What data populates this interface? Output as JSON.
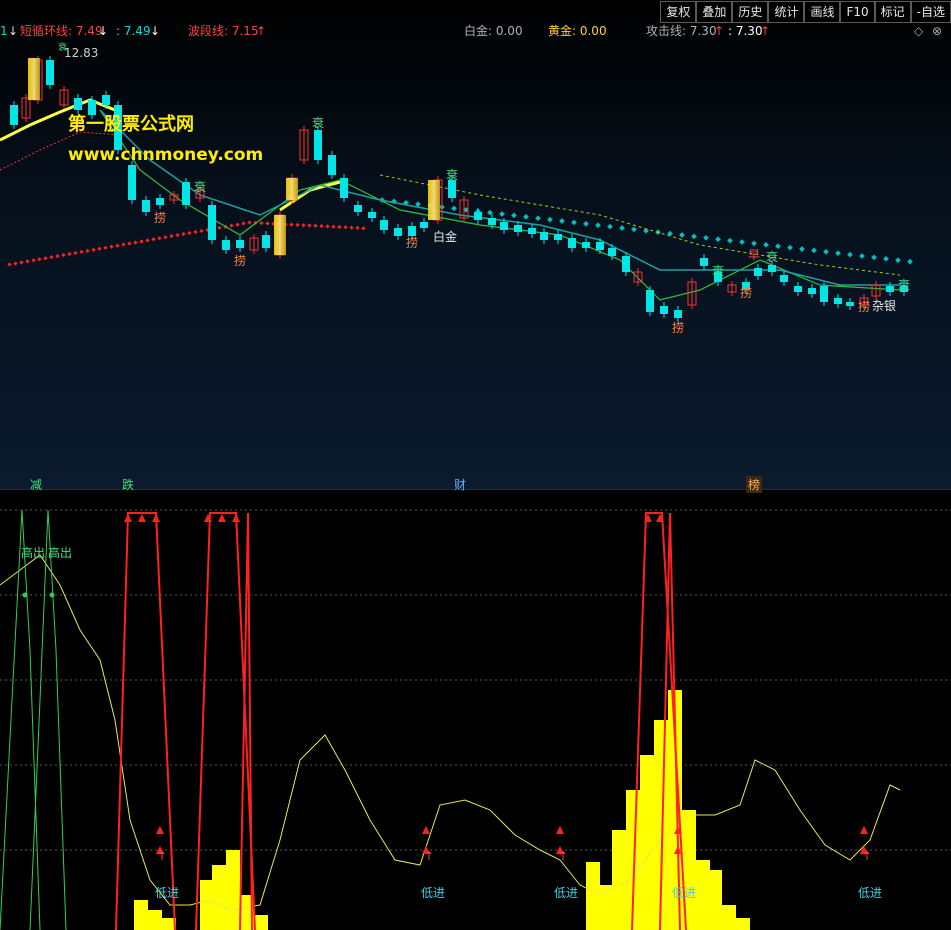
{
  "toolbar": [
    "复权",
    "叠加",
    "历史",
    "统计",
    "画线",
    "F10",
    "标记",
    "-自选"
  ],
  "indicators": {
    "short_cycle_label": "短循环线: 7.49",
    "short_cycle_arrow": "↓",
    "short_cycle_value": ": 7.49",
    "short_cycle_value_arrow": "↓",
    "wave_label": "波段线: 7.15",
    "wave_arrow": "↑",
    "silver_label": "白金: 0.00",
    "gold_label": "黄金: 0.00",
    "attack_label": "攻击线: 7.30",
    "attack_arrow": "↑",
    "attack_value": ": 7.30",
    "attack_value_arrow": "↑"
  },
  "icons": {
    "settings": "diamond-icon",
    "close": "close-circle-icon"
  },
  "price_label": "12.83",
  "watermark": {
    "line1": "第一股票公式网",
    "line2": "www.chnmoney.com"
  },
  "signals_top": [
    "衰",
    "衰",
    "衰",
    "衰",
    "衰",
    "衰",
    "衰"
  ],
  "signals_catch": [
    "捞",
    "捞",
    "捞",
    "捞",
    "捞",
    "捞"
  ],
  "signal_bai": "白金",
  "signal_zayin": "杂银",
  "signal_zao": "早",
  "markers": [
    "减",
    "跌",
    "财",
    "榜"
  ],
  "bottom_labels": {
    "high_out_1": "高出",
    "high_out_2": "高出",
    "low_in": "低进"
  },
  "low_in_positions": [
    "低进",
    "低进",
    "低进",
    "低进",
    "低进"
  ],
  "colors": {
    "up": "#ff3030",
    "down": "#00e5e5",
    "ma_yellow": "#ffff40",
    "ma_green": "#30c040",
    "ma_teal": "#20a0a0",
    "dots_red": "#ff2020",
    "dots_teal": "#00c0c0",
    "bar_yellow": "#ffff00"
  }
}
